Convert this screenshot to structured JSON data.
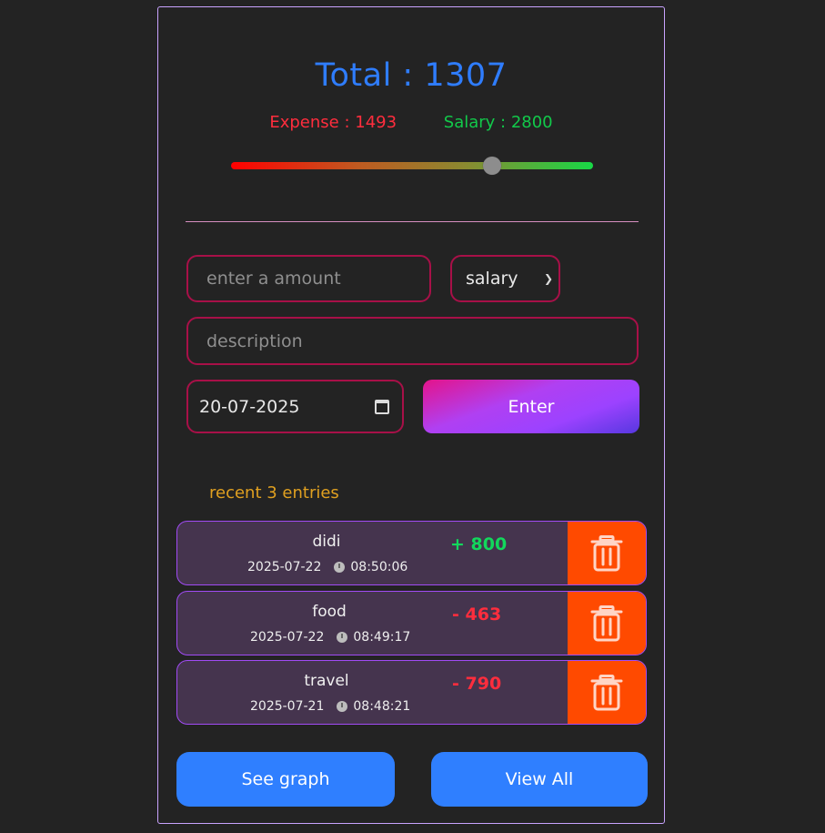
{
  "summary": {
    "total_text": "Total : 1307",
    "expense_text": "Expense : 1493",
    "salary_text": "Salary : 2800",
    "balance_fraction": 0.72
  },
  "form": {
    "amount_placeholder": "enter a amount",
    "type_selected": "salary",
    "description_placeholder": "description",
    "date_value": "20-07-2025",
    "enter_label": "Enter"
  },
  "recent": {
    "title": "recent 3 entries",
    "entries": [
      {
        "description": "didi",
        "date": "2025-07-22",
        "time": "08:50:06",
        "amount": "+ 800",
        "kind": "income"
      },
      {
        "description": "food",
        "date": "2025-07-22",
        "time": "08:49:17",
        "amount": "- 463",
        "kind": "expense"
      },
      {
        "description": "travel",
        "date": "2025-07-21",
        "time": "08:48:21",
        "amount": "- 790",
        "kind": "expense"
      }
    ]
  },
  "actions": {
    "see_graph_label": "See graph",
    "view_all_label": "View All"
  },
  "colors": {
    "total": "#2f7dff",
    "expense": "#ff2d3d",
    "salary": "#12c94a",
    "delete_bg": "#ff4a00",
    "button_blue": "#2f7fff"
  }
}
